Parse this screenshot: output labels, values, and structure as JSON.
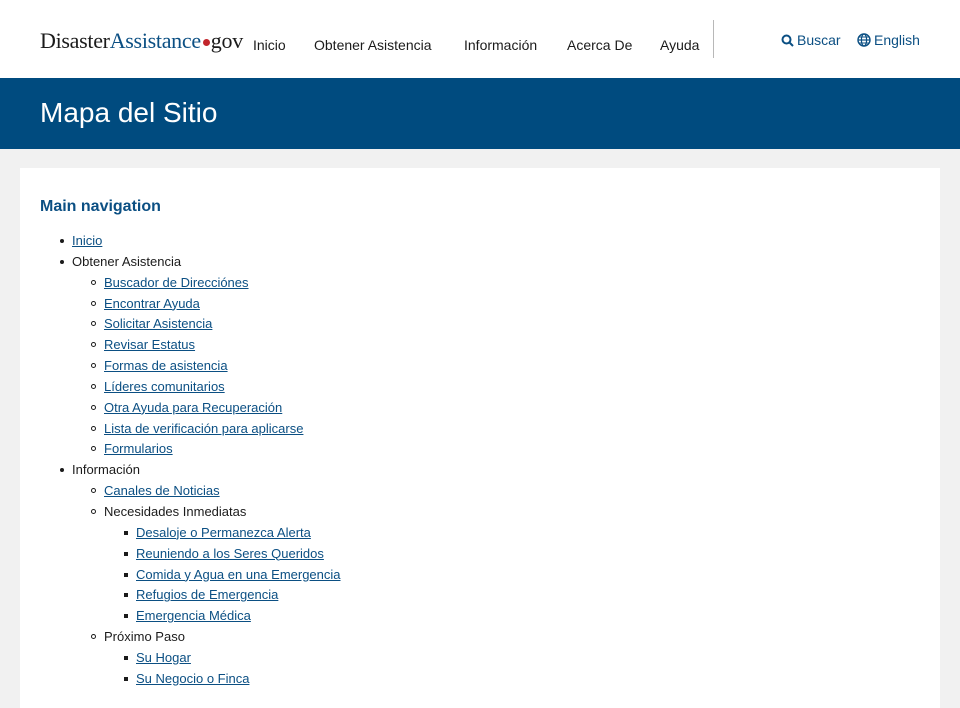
{
  "header": {
    "logo": {
      "part1": "Disaster",
      "part2": "Assistance",
      "part3": "gov"
    },
    "nav": [
      "Inicio",
      "Obtener Asistencia",
      "Información",
      "Acerca De",
      "Ayuda"
    ],
    "search_label": "Buscar",
    "language_label": "English"
  },
  "banner": {
    "title": "Mapa del Sitio"
  },
  "sitemap": {
    "heading": "Main navigation",
    "items": {
      "inicio": "Inicio",
      "obtener": {
        "label": "Obtener Asistencia",
        "children": [
          "Buscador de Direcciónes",
          "Encontrar Ayuda",
          "Solicitar Asistencia",
          "Revisar Estatus",
          "Formas de asistencia",
          "Líderes comunitarios",
          "Otra Ayuda para Recuperación",
          "Lista de verificación para aplicarse",
          "Formularios"
        ]
      },
      "informacion": {
        "label": "Información",
        "canales": "Canales de Noticias",
        "necesidades": {
          "label": "Necesidades Inmediatas",
          "children": [
            "Desaloje o Permanezca Alerta",
            "Reuniendo a los Seres Queridos",
            "Comida y Agua en una Emergencia",
            "Refugios de Emergencia",
            "Emergencia Médica"
          ]
        },
        "proximo": {
          "label": "Próximo Paso",
          "children": [
            "Su Hogar",
            "Su Negocio o Finca"
          ]
        }
      }
    }
  },
  "colors": {
    "brand_blue": "#004b7f",
    "link_blue": "#0b4f83",
    "logo_dot": "#c2262c",
    "page_bg": "#f1f1f1"
  }
}
